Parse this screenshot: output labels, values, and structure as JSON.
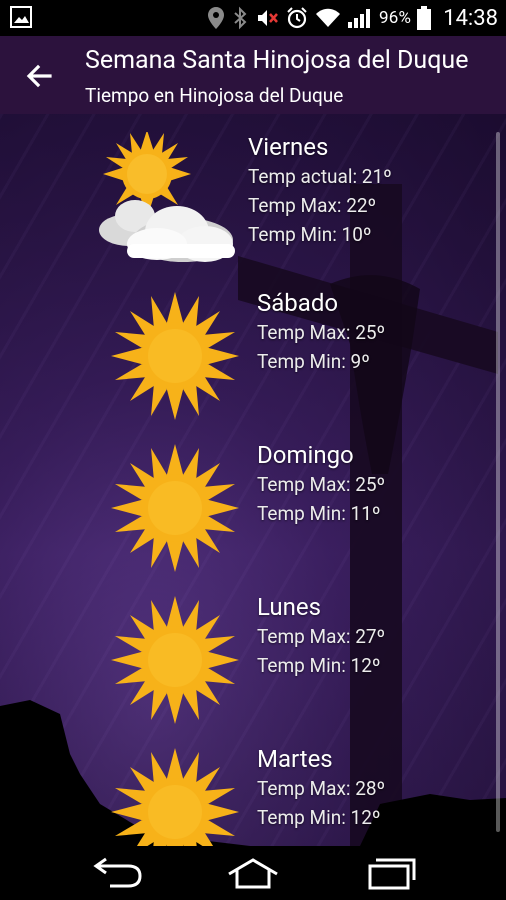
{
  "status_bar": {
    "battery_percent": "96%",
    "time": "14:38",
    "icons": [
      "image-icon",
      "location-icon",
      "bluetooth-icon",
      "mute-icon",
      "alarm-icon",
      "wifi-icon",
      "signal-icon",
      "battery-icon"
    ]
  },
  "app_bar": {
    "title": "Semana Santa Hinojosa del Duque",
    "subtitle": "Tiempo en Hinojosa del Duque"
  },
  "days": [
    {
      "name": "Viernes",
      "icon": "sun-cloud-icon",
      "lines": [
        "Temp actual: 21º",
        "Temp Max: 22º",
        "Temp Min: 10º"
      ]
    },
    {
      "name": "Sábado",
      "icon": "sun-icon",
      "lines": [
        "Temp Max: 25º",
        "Temp Min: 9º"
      ]
    },
    {
      "name": "Domingo",
      "icon": "sun-icon",
      "lines": [
        "Temp Max: 25º",
        "Temp Min: 11º"
      ]
    },
    {
      "name": "Lunes",
      "icon": "sun-icon",
      "lines": [
        "Temp Max: 27º",
        "Temp Min: 12º"
      ]
    },
    {
      "name": "Martes",
      "icon": "sun-icon",
      "lines": [
        "Temp Max: 28º",
        "Temp Min: 12º"
      ]
    }
  ],
  "colors": {
    "app_bar": "#2c123d",
    "sun": "#f7b219",
    "background": "#3a1f5e"
  }
}
